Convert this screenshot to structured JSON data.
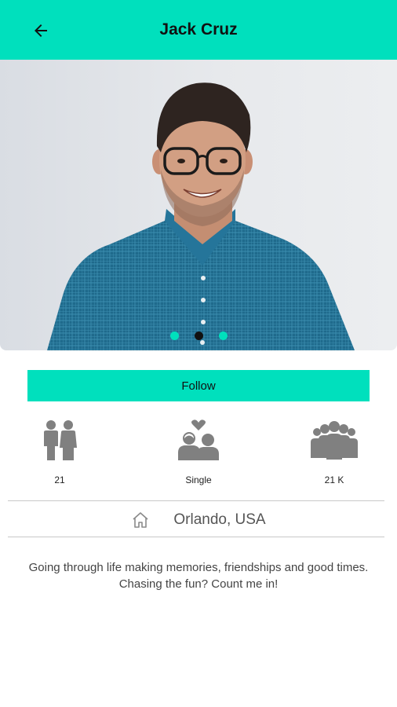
{
  "header": {
    "title": "Jack Cruz",
    "back_icon": "arrow-left-icon",
    "background": "#00e0bd"
  },
  "carousel": {
    "total": 3,
    "active_index": 1
  },
  "actions": {
    "follow_label": "Follow"
  },
  "stats": [
    {
      "icon": "couple-icon",
      "value": "21"
    },
    {
      "icon": "single-heart-icon",
      "value": "Single"
    },
    {
      "icon": "group-icon",
      "value": "21 K"
    }
  ],
  "location": {
    "icon": "home-icon",
    "text": "Orlando, USA"
  },
  "bio": "Going through life making memories, friendships and good times. Chasing the fun? Count me in!",
  "colors": {
    "accent": "#00e0bd",
    "icon_gray": "#808080"
  }
}
